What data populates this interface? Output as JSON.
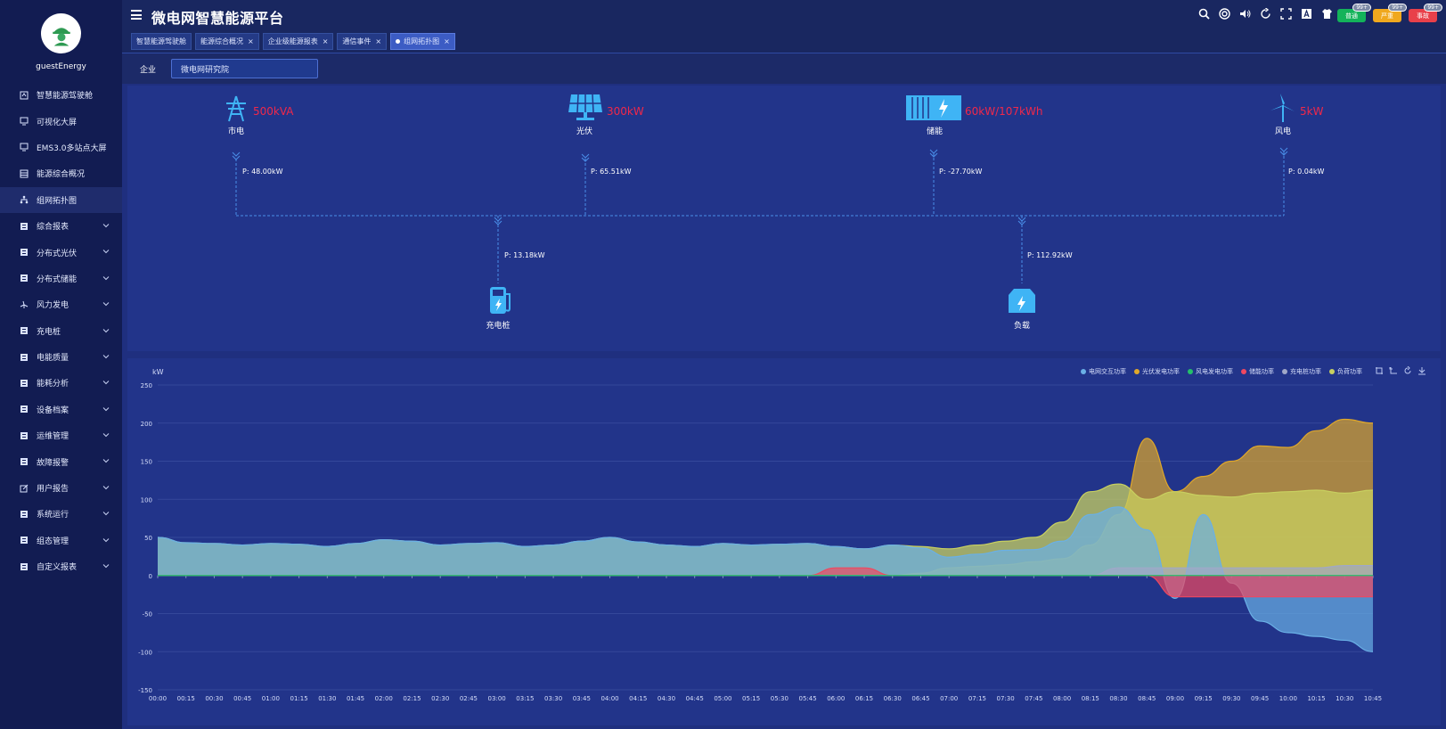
{
  "user": {
    "name": "guestEnergy"
  },
  "menu": [
    {
      "label": "智慧能源驾驶舱",
      "icon": "cockpit-icon",
      "expandable": false
    },
    {
      "label": "可视化大屏",
      "icon": "monitor-icon",
      "expandable": false
    },
    {
      "label": "EMS3.0多站点大屏",
      "icon": "monitor-icon",
      "expandable": false
    },
    {
      "label": "能源综合概况",
      "icon": "grid-icon",
      "expandable": false
    },
    {
      "label": "组网拓扑图",
      "icon": "topology-icon",
      "expandable": false,
      "active": true
    },
    {
      "label": "综合报表",
      "icon": "report-icon",
      "expandable": true
    },
    {
      "label": "分布式光伏",
      "icon": "solar-icon",
      "expandable": true
    },
    {
      "label": "分布式储能",
      "icon": "storage-icon",
      "expandable": true
    },
    {
      "label": "风力发电",
      "icon": "wind-icon",
      "expandable": true
    },
    {
      "label": "充电桩",
      "icon": "charger-icon",
      "expandable": true
    },
    {
      "label": "电能质量",
      "icon": "quality-icon",
      "expandable": true
    },
    {
      "label": "能耗分析",
      "icon": "analysis-icon",
      "expandable": true
    },
    {
      "label": "设备档案",
      "icon": "archive-icon",
      "expandable": true
    },
    {
      "label": "运维管理",
      "icon": "ops-icon",
      "expandable": true
    },
    {
      "label": "故障报警",
      "icon": "alarm-icon",
      "expandable": true
    },
    {
      "label": "用户报告",
      "icon": "edit-icon",
      "expandable": true
    },
    {
      "label": "系统运行",
      "icon": "system-icon",
      "expandable": true
    },
    {
      "label": "组态管理",
      "icon": "config-icon",
      "expandable": true
    },
    {
      "label": "自定义报表",
      "icon": "custom-report-icon",
      "expandable": true
    }
  ],
  "header": {
    "title": "微电网智慧能源平台",
    "tabs": [
      {
        "label": "智慧能源驾驶舱",
        "closable": false,
        "active": false
      },
      {
        "label": "能源综合概况",
        "closable": true,
        "active": false
      },
      {
        "label": "企业级能源报表",
        "closable": true,
        "active": false
      },
      {
        "label": "通信事件",
        "closable": true,
        "active": false
      },
      {
        "label": "组网拓扑图",
        "closable": true,
        "active": true
      }
    ],
    "close_glyph": "×",
    "tools": [
      "search-icon",
      "target-icon",
      "volume-icon",
      "refresh-icon",
      "fullscreen-icon",
      "font-icon",
      "shirt-icon"
    ],
    "badges": [
      {
        "label": "普通",
        "count": "99+",
        "color": "#13b35a"
      },
      {
        "label": "严重",
        "count": "99+",
        "color": "#f0a81e"
      },
      {
        "label": "事故",
        "count": "99+",
        "color": "#e8404a"
      }
    ]
  },
  "filter": {
    "label": "企业",
    "value": "微电网研究院"
  },
  "topology": {
    "sources": [
      {
        "name": "市电",
        "capacity": "500kVA",
        "power": "P: 48.00kW",
        "icon": "power-tower-icon"
      },
      {
        "name": "光伏",
        "capacity": "300kW",
        "power": "P: 65.51kW",
        "icon": "solar-panel-icon"
      },
      {
        "name": "储能",
        "capacity": "60kW/107kWh",
        "power": "P: -27.70kW",
        "icon": "battery-container-icon"
      },
      {
        "name": "风电",
        "capacity": "5kW",
        "power": "P: 0.04kW",
        "icon": "wind-turbine-icon"
      }
    ],
    "loads": [
      {
        "name": "充电桩",
        "power": "P: 13.18kW",
        "icon": "charging-pile-icon"
      },
      {
        "name": "负载",
        "power": "P: 112.92kW",
        "icon": "load-icon"
      }
    ]
  },
  "chart_data": {
    "type": "area",
    "ylabel": "kW",
    "ylim": [
      -150,
      250
    ],
    "yticks": [
      -150,
      -100,
      -50,
      0,
      50,
      100,
      150,
      200,
      250
    ],
    "grid": true,
    "legend_position": "top-right",
    "x": [
      "00:00",
      "00:15",
      "00:30",
      "00:45",
      "01:00",
      "01:15",
      "01:30",
      "01:45",
      "02:00",
      "02:15",
      "02:30",
      "02:45",
      "03:00",
      "03:15",
      "03:30",
      "03:45",
      "04:00",
      "04:15",
      "04:30",
      "04:45",
      "05:00",
      "05:15",
      "05:30",
      "05:45",
      "06:00",
      "06:15",
      "06:30",
      "06:45",
      "07:00",
      "07:15",
      "07:30",
      "07:45",
      "08:00",
      "08:15",
      "08:30",
      "08:45",
      "09:00",
      "09:15",
      "09:30",
      "09:45",
      "10:00",
      "10:15",
      "10:30",
      "10:45"
    ],
    "series": [
      {
        "name": "电网交互功率",
        "color": "#6ab0e6",
        "values": [
          50,
          43,
          42,
          40,
          42,
          41,
          38,
          42,
          47,
          45,
          40,
          42,
          43,
          38,
          40,
          45,
          50,
          44,
          40,
          38,
          42,
          40,
          41,
          42,
          38,
          35,
          40,
          36,
          24,
          28,
          33,
          34,
          45,
          80,
          90,
          60,
          -30,
          80,
          -10,
          -60,
          -75,
          -80,
          -85,
          -100
        ]
      },
      {
        "name": "光伏发电功率",
        "color": "#e0a82a",
        "values": [
          0,
          0,
          0,
          0,
          0,
          0,
          0,
          0,
          0,
          0,
          0,
          0,
          0,
          0,
          0,
          0,
          0,
          0,
          0,
          0,
          0,
          0,
          0,
          0,
          0,
          0,
          0,
          3,
          10,
          12,
          14,
          18,
          22,
          40,
          80,
          180,
          110,
          130,
          150,
          170,
          168,
          190,
          205,
          200
        ]
      },
      {
        "name": "风电发电功率",
        "color": "#24c06a",
        "values": [
          0,
          0,
          0,
          0,
          0,
          0,
          0,
          0,
          0,
          0,
          0,
          0,
          0,
          0,
          0,
          0,
          0,
          0,
          0,
          0,
          0,
          0,
          0,
          0,
          0,
          0,
          0,
          0,
          0,
          0,
          0,
          0,
          0,
          0,
          0,
          0,
          0,
          0,
          0,
          0,
          0,
          0,
          0,
          0
        ]
      },
      {
        "name": "储能功率",
        "color": "#f04860",
        "values": [
          0,
          0,
          0,
          0,
          0,
          0,
          0,
          0,
          0,
          0,
          0,
          0,
          0,
          0,
          0,
          0,
          0,
          0,
          0,
          0,
          0,
          0,
          0,
          0,
          10,
          10,
          0,
          0,
          0,
          0,
          0,
          0,
          0,
          0,
          0,
          0,
          -28,
          -28,
          -28,
          -28,
          -28,
          -28,
          -28,
          -28
        ]
      },
      {
        "name": "充电桩功率",
        "color": "#a0a8c8",
        "values": [
          0,
          0,
          0,
          0,
          0,
          0,
          0,
          0,
          0,
          0,
          0,
          0,
          0,
          0,
          0,
          0,
          0,
          0,
          0,
          0,
          0,
          0,
          0,
          0,
          0,
          0,
          0,
          0,
          0,
          0,
          0,
          0,
          0,
          0,
          10,
          10,
          10,
          10,
          10,
          10,
          10,
          10,
          13,
          13
        ]
      },
      {
        "name": "负荷功率",
        "color": "#c8d060",
        "values": [
          50,
          43,
          42,
          40,
          42,
          41,
          38,
          42,
          47,
          45,
          40,
          42,
          43,
          38,
          40,
          45,
          50,
          44,
          40,
          38,
          42,
          40,
          41,
          42,
          38,
          35,
          40,
          38,
          35,
          40,
          45,
          50,
          70,
          110,
          120,
          100,
          110,
          105,
          103,
          108,
          110,
          112,
          108,
          112
        ]
      }
    ]
  }
}
